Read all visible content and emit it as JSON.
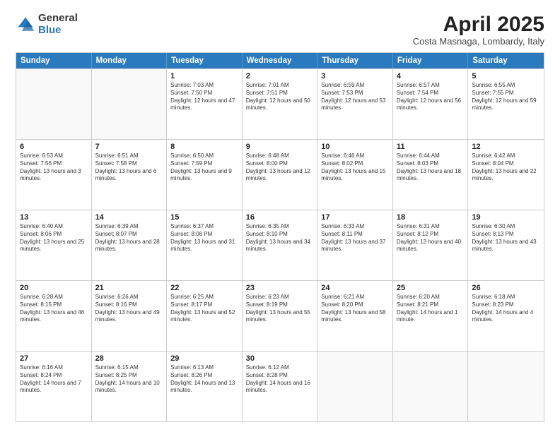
{
  "logo": {
    "general": "General",
    "blue": "Blue"
  },
  "header": {
    "month": "April 2025",
    "location": "Costa Masnaga, Lombardy, Italy"
  },
  "weekdays": [
    "Sunday",
    "Monday",
    "Tuesday",
    "Wednesday",
    "Thursday",
    "Friday",
    "Saturday"
  ],
  "rows": [
    [
      {
        "day": "",
        "info": ""
      },
      {
        "day": "",
        "info": ""
      },
      {
        "day": "1",
        "info": "Sunrise: 7:03 AM\nSunset: 7:50 PM\nDaylight: 12 hours and 47 minutes."
      },
      {
        "day": "2",
        "info": "Sunrise: 7:01 AM\nSunset: 7:51 PM\nDaylight: 12 hours and 50 minutes."
      },
      {
        "day": "3",
        "info": "Sunrise: 6:59 AM\nSunset: 7:53 PM\nDaylight: 12 hours and 53 minutes."
      },
      {
        "day": "4",
        "info": "Sunrise: 6:57 AM\nSunset: 7:54 PM\nDaylight: 12 hours and 56 minutes."
      },
      {
        "day": "5",
        "info": "Sunrise: 6:55 AM\nSunset: 7:55 PM\nDaylight: 12 hours and 59 minutes."
      }
    ],
    [
      {
        "day": "6",
        "info": "Sunrise: 6:53 AM\nSunset: 7:56 PM\nDaylight: 13 hours and 3 minutes."
      },
      {
        "day": "7",
        "info": "Sunrise: 6:51 AM\nSunset: 7:58 PM\nDaylight: 13 hours and 6 minutes."
      },
      {
        "day": "8",
        "info": "Sunrise: 6:50 AM\nSunset: 7:59 PM\nDaylight: 13 hours and 9 minutes."
      },
      {
        "day": "9",
        "info": "Sunrise: 6:48 AM\nSunset: 8:00 PM\nDaylight: 13 hours and 12 minutes."
      },
      {
        "day": "10",
        "info": "Sunrise: 6:46 AM\nSunset: 8:02 PM\nDaylight: 13 hours and 15 minutes."
      },
      {
        "day": "11",
        "info": "Sunrise: 6:44 AM\nSunset: 8:03 PM\nDaylight: 13 hours and 18 minutes."
      },
      {
        "day": "12",
        "info": "Sunrise: 6:42 AM\nSunset: 8:04 PM\nDaylight: 13 hours and 22 minutes."
      }
    ],
    [
      {
        "day": "13",
        "info": "Sunrise: 6:40 AM\nSunset: 8:06 PM\nDaylight: 13 hours and 25 minutes."
      },
      {
        "day": "14",
        "info": "Sunrise: 6:39 AM\nSunset: 8:07 PM\nDaylight: 13 hours and 28 minutes."
      },
      {
        "day": "15",
        "info": "Sunrise: 6:37 AM\nSunset: 8:08 PM\nDaylight: 13 hours and 31 minutes."
      },
      {
        "day": "16",
        "info": "Sunrise: 6:35 AM\nSunset: 8:10 PM\nDaylight: 13 hours and 34 minutes."
      },
      {
        "day": "17",
        "info": "Sunrise: 6:33 AM\nSunset: 8:11 PM\nDaylight: 13 hours and 37 minutes."
      },
      {
        "day": "18",
        "info": "Sunrise: 6:31 AM\nSunset: 8:12 PM\nDaylight: 13 hours and 40 minutes."
      },
      {
        "day": "19",
        "info": "Sunrise: 6:30 AM\nSunset: 8:13 PM\nDaylight: 13 hours and 43 minutes."
      }
    ],
    [
      {
        "day": "20",
        "info": "Sunrise: 6:28 AM\nSunset: 8:15 PM\nDaylight: 13 hours and 46 minutes."
      },
      {
        "day": "21",
        "info": "Sunrise: 6:26 AM\nSunset: 8:16 PM\nDaylight: 13 hours and 49 minutes."
      },
      {
        "day": "22",
        "info": "Sunrise: 6:25 AM\nSunset: 8:17 PM\nDaylight: 13 hours and 52 minutes."
      },
      {
        "day": "23",
        "info": "Sunrise: 6:23 AM\nSunset: 8:19 PM\nDaylight: 13 hours and 55 minutes."
      },
      {
        "day": "24",
        "info": "Sunrise: 6:21 AM\nSunset: 8:20 PM\nDaylight: 13 hours and 58 minutes."
      },
      {
        "day": "25",
        "info": "Sunrise: 6:20 AM\nSunset: 8:21 PM\nDaylight: 14 hours and 1 minute."
      },
      {
        "day": "26",
        "info": "Sunrise: 6:18 AM\nSunset: 8:23 PM\nDaylight: 14 hours and 4 minutes."
      }
    ],
    [
      {
        "day": "27",
        "info": "Sunrise: 6:16 AM\nSunset: 8:24 PM\nDaylight: 14 hours and 7 minutes."
      },
      {
        "day": "28",
        "info": "Sunrise: 6:15 AM\nSunset: 8:25 PM\nDaylight: 14 hours and 10 minutes."
      },
      {
        "day": "29",
        "info": "Sunrise: 6:13 AM\nSunset: 8:26 PM\nDaylight: 14 hours and 13 minutes."
      },
      {
        "day": "30",
        "info": "Sunrise: 6:12 AM\nSunset: 8:28 PM\nDaylight: 14 hours and 16 minutes."
      },
      {
        "day": "",
        "info": ""
      },
      {
        "day": "",
        "info": ""
      },
      {
        "day": "",
        "info": ""
      }
    ]
  ]
}
